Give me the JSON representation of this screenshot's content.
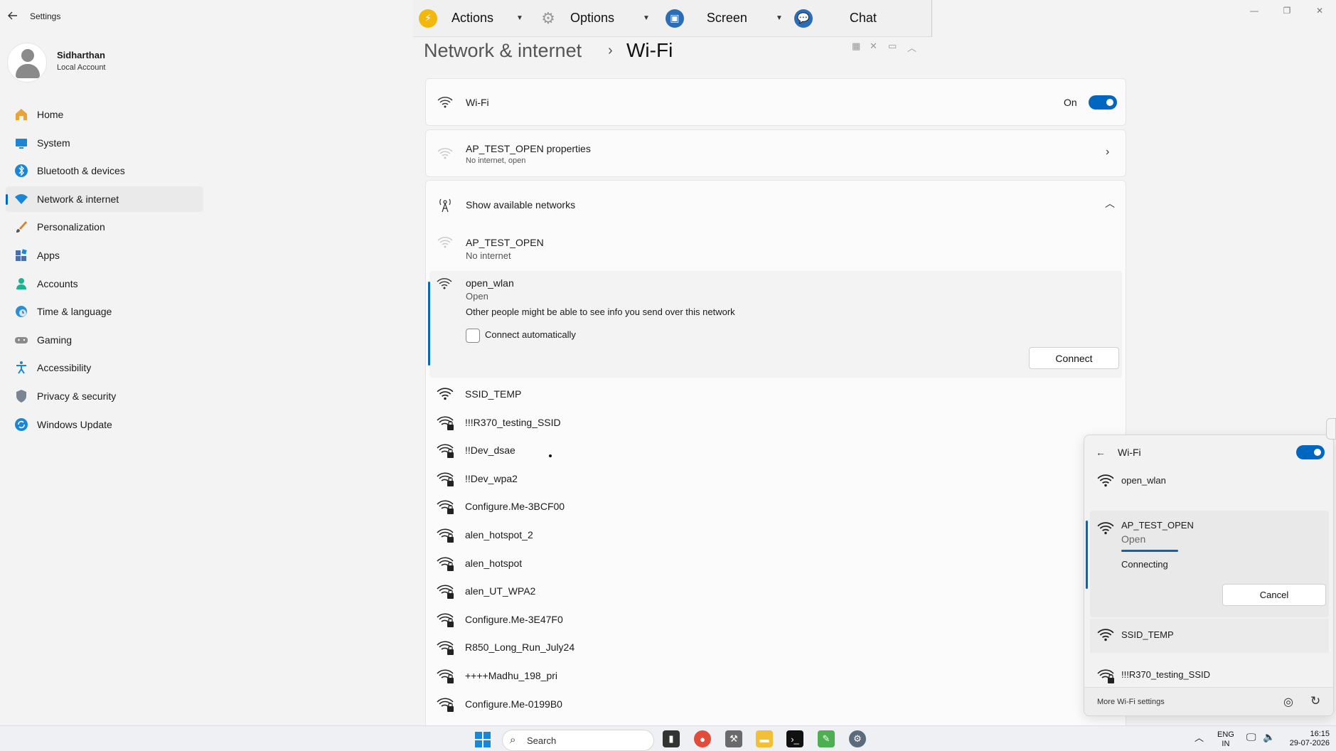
{
  "app": {
    "title": "Settings"
  },
  "user": {
    "name": "Sidharthan",
    "account_type": "Local Account"
  },
  "toolbar": {
    "items": [
      {
        "label": "Actions",
        "color": "#f2b90c"
      },
      {
        "label": "Options",
        "color": "#b0b0b0"
      },
      {
        "label": "Screen",
        "color": "#2d6db5"
      },
      {
        "label": "Chat",
        "color": "#2d6db5"
      }
    ]
  },
  "sidebar": {
    "items": [
      {
        "label": "Home",
        "icon": "home-icon"
      },
      {
        "label": "System",
        "icon": "monitor-icon"
      },
      {
        "label": "Bluetooth & devices",
        "icon": "bluetooth-icon"
      },
      {
        "label": "Network & internet",
        "icon": "wifi-icon",
        "active": true
      },
      {
        "label": "Personalization",
        "icon": "brush-icon"
      },
      {
        "label": "Apps",
        "icon": "apps-icon"
      },
      {
        "label": "Accounts",
        "icon": "person-icon"
      },
      {
        "label": "Time & language",
        "icon": "clock-globe-icon"
      },
      {
        "label": "Gaming",
        "icon": "gamepad-icon"
      },
      {
        "label": "Accessibility",
        "icon": "accessibility-icon"
      },
      {
        "label": "Privacy & security",
        "icon": "shield-icon"
      },
      {
        "label": "Windows Update",
        "icon": "update-icon"
      }
    ]
  },
  "breadcrumb": {
    "parent": "Network & internet",
    "separator": "›",
    "current": "Wi-Fi"
  },
  "wifi": {
    "label": "Wi-Fi",
    "state": "On",
    "properties": {
      "title": "AP_TEST_OPEN properties",
      "subtitle": "No internet, open"
    },
    "show_networks": "Show available networks",
    "first_network": {
      "name": "AP_TEST_OPEN",
      "status": "No internet"
    },
    "expanded": {
      "name": "open_wlan",
      "status": "Open",
      "warning": "Other people might be able to see info you send over this network",
      "checkbox_label": "Connect automatically",
      "connect_label": "Connect"
    },
    "networks": [
      "SSID_TEMP",
      "!!!R370_testing_SSID",
      "!!Dev_dsae",
      "!!Dev_wpa2",
      "Configure.Me-3BCF00",
      "alen_hotspot_2",
      "alen_hotspot",
      "alen_UT_WPA2",
      "Configure.Me-3E47F0",
      "R850_Long_Run_July24",
      "++++Madhu_198_pri",
      "Configure.Me-0199B0"
    ]
  },
  "flyout": {
    "title": "Wi-Fi",
    "networks": [
      "open_wlan",
      "SSID_TEMP",
      "!!!R370_testing_SSID"
    ],
    "connecting": {
      "name": "AP_TEST_OPEN",
      "status": "Open",
      "progress": "Connecting",
      "cancel_label": "Cancel"
    },
    "more_settings": "More Wi-Fi settings"
  },
  "taskbar": {
    "search_placeholder": "Search",
    "lang_line1": "ENG",
    "lang_line2": "IN",
    "time": "16:15",
    "date": "29-07-2026"
  },
  "colors": {
    "accent": "#0067c0"
  }
}
